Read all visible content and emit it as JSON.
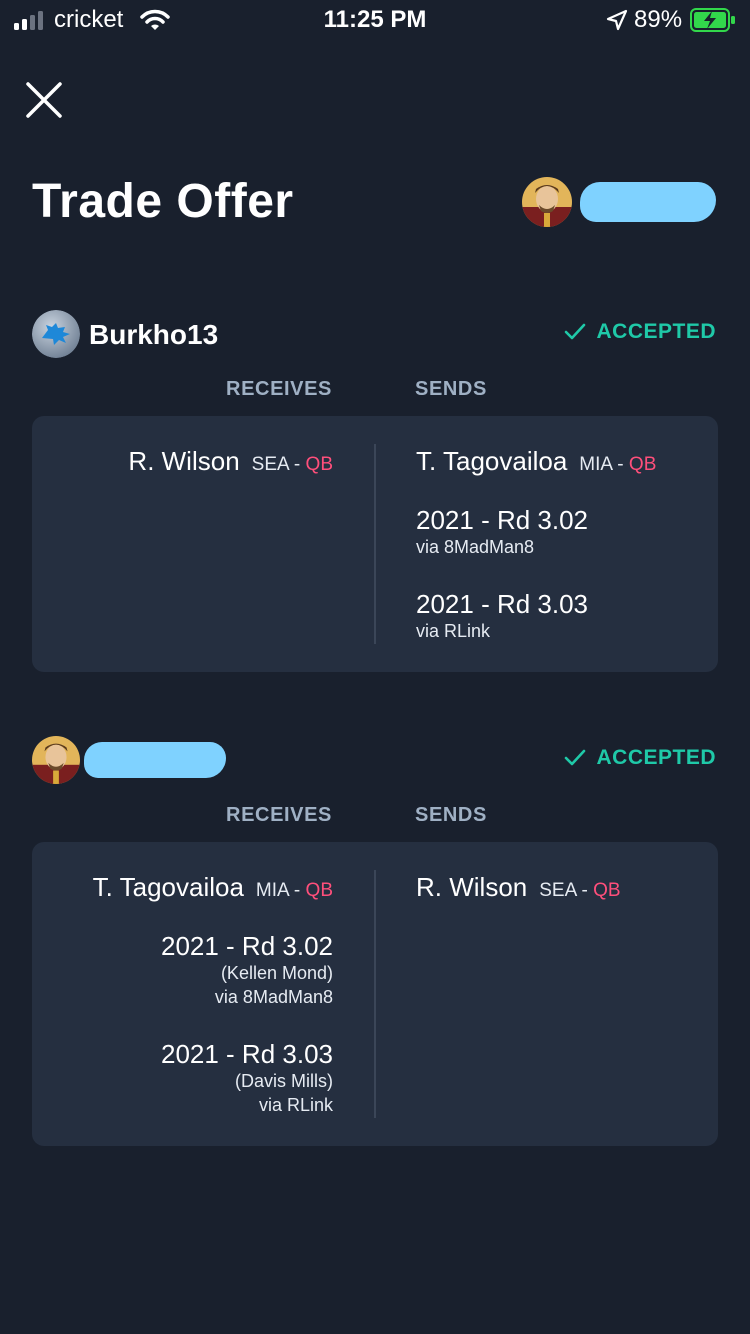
{
  "status_bar": {
    "carrier": "cricket",
    "time": "11:25 PM",
    "battery": "89%"
  },
  "header": {
    "title": "Trade Offer"
  },
  "parties": [
    {
      "name": "Burkho13",
      "status": "ACCEPTED",
      "receives_label": "RECEIVES",
      "sends_label": "SENDS",
      "receives": {
        "player": {
          "name": "R. Wilson",
          "team": "SEA",
          "sep": " - ",
          "pos": "QB"
        }
      },
      "sends": {
        "player": {
          "name": "T. Tagovailoa",
          "team": "MIA",
          "sep": " - ",
          "pos": "QB"
        },
        "picks": [
          {
            "title": "2021 - Rd 3.02",
            "via": "via 8MadMan8"
          },
          {
            "title": "2021 - Rd 3.03",
            "via": "via RLink"
          }
        ]
      }
    },
    {
      "name": "",
      "status": "ACCEPTED",
      "receives_label": "RECEIVES",
      "sends_label": "SENDS",
      "receives": {
        "player": {
          "name": "T. Tagovailoa",
          "team": "MIA",
          "sep": " - ",
          "pos": "QB"
        },
        "picks": [
          {
            "title": "2021 - Rd 3.02",
            "player": "(Kellen Mond)",
            "via": "via 8MadMan8"
          },
          {
            "title": "2021 - Rd 3.03",
            "player": "(Davis Mills)",
            "via": "via RLink"
          }
        ]
      },
      "sends": {
        "player": {
          "name": "R. Wilson",
          "team": "SEA",
          "sep": " - ",
          "pos": "QB"
        }
      }
    }
  ],
  "colors": {
    "background": "#19202d",
    "card": "#252f40",
    "accepted": "#1fc9a8",
    "position": "#ff4f7b",
    "redaction": "#7fd2ff"
  }
}
